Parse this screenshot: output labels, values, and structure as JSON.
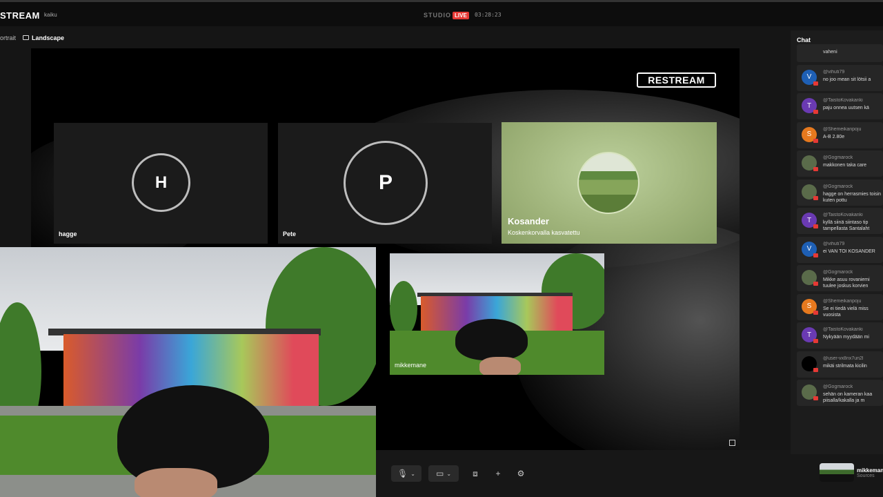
{
  "header": {
    "brand": "STREAM",
    "workspace": "kaiku",
    "studio_label": "STUDIO",
    "live_label": "LIVE",
    "timer": "03:28:23"
  },
  "layout_toggle": {
    "portrait": "ortrait",
    "landscape": "Landscape"
  },
  "stage": {
    "watermark": "RESTREAM",
    "participants": [
      {
        "initial": "H",
        "name": "hagge"
      },
      {
        "initial": "P",
        "name": "Pete"
      },
      {
        "name": "Kosander",
        "subtitle": "Koskenkorvalla kasvatettu"
      }
    ],
    "camera_label": "mikkemane"
  },
  "chat": {
    "title": "Chat",
    "messages": [
      {
        "user": "",
        "text": "vaheni",
        "avatar": "",
        "color": "#262626"
      },
      {
        "user": "@vihuti79",
        "text": "no joo mean sit lötsii a",
        "avatar": "V",
        "color": "#1e5fb4"
      },
      {
        "user": "@TaistoKovakanki",
        "text": "paju onnea uutsen kä",
        "avatar": "T",
        "color": "#6a3ab2"
      },
      {
        "user": "@Shemeikanpoju",
        "text": "A-B 2.80e",
        "avatar": "S",
        "color": "#e6791e"
      },
      {
        "user": "@Gogmarock",
        "text": "makkonen taka care",
        "avatar": "",
        "color": "#5a6b4a"
      },
      {
        "user": "@Gogmarock",
        "text": "hagge on herrasmies toisin kuten pottu",
        "avatar": "",
        "color": "#5a6b4a"
      },
      {
        "user": "@TaistoKovakanki",
        "text": "kyllä siinä siintaso tip tampellasta Santalaht",
        "avatar": "T",
        "color": "#6a3ab2"
      },
      {
        "user": "@vihuti79",
        "text": "ei VAN TOI KOSANDER",
        "avatar": "V",
        "color": "#1e5fb4"
      },
      {
        "user": "@Gogmarock",
        "text": "Mikke asuu rovaniemi tuulee joskus korvien",
        "avatar": "",
        "color": "#5a6b4a"
      },
      {
        "user": "@Shemeikanpoju",
        "text": "Se ei tiedä vielä miss vuosista",
        "avatar": "S",
        "color": "#e6791e"
      },
      {
        "user": "@TaistoKovakanki",
        "text": "Nykyään myydään mi",
        "avatar": "T",
        "color": "#6a3ab2"
      },
      {
        "user": "@user-vx8nx7un2l",
        "text": "mikäi strilmata kicilin",
        "avatar": "",
        "color": "#000000"
      },
      {
        "user": "@Gogmarock",
        "text": "sehän on kameran kaa piisalla/kakalla ja m",
        "avatar": "",
        "color": "#5a6b4a"
      }
    ]
  },
  "self_view": {
    "name": "mikkemane",
    "sub": "Sources"
  },
  "colors": {
    "live": "#e53935",
    "background": "#151515"
  }
}
